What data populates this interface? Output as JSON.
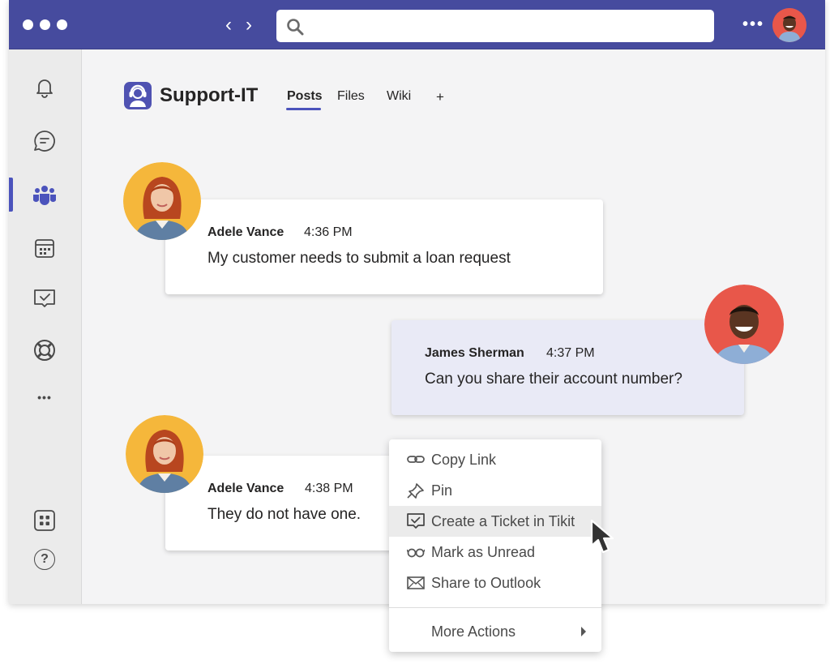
{
  "titlebar": {
    "nav_back": "‹",
    "nav_forward": "›",
    "more": "•••",
    "search": {
      "placeholder": ""
    }
  },
  "rail": {
    "items": [
      {
        "name": "activity",
        "icon": "bell-icon"
      },
      {
        "name": "chat",
        "icon": "chat-icon"
      },
      {
        "name": "teams",
        "icon": "teams-icon",
        "active": true
      },
      {
        "name": "calendar",
        "icon": "calendar-icon"
      },
      {
        "name": "tasks",
        "icon": "task-check-icon"
      },
      {
        "name": "help-desk",
        "icon": "lifebuoy-icon"
      },
      {
        "name": "more",
        "icon": "ellipsis-icon",
        "label": "•••"
      },
      {
        "name": "apps",
        "icon": "apps-icon"
      },
      {
        "name": "help",
        "icon": "help-icon",
        "label": "?"
      }
    ]
  },
  "channel": {
    "title": "Support-IT",
    "tabs": [
      {
        "label": "Posts",
        "active": true
      },
      {
        "label": "Files"
      },
      {
        "label": "Wiki"
      },
      {
        "label": "+"
      }
    ]
  },
  "messages": [
    {
      "author": "Adele Vance",
      "time": "4:36 PM",
      "text": "My customer needs to submit a loan request"
    },
    {
      "author": "James Sherman",
      "time": "4:37 PM",
      "text": "Can you share their account number?"
    },
    {
      "author": "Adele Vance",
      "time": "4:38 PM",
      "text": "They do not have one."
    }
  ],
  "context_menu": {
    "items": [
      {
        "label": "Copy Link",
        "icon": "link-icon"
      },
      {
        "label": "Pin",
        "icon": "pin-icon"
      },
      {
        "label": "Create a Ticket in Tikit",
        "icon": "ticket-check-icon",
        "highlighted": true
      },
      {
        "label": "Mark as Unread",
        "icon": "glasses-icon"
      },
      {
        "label": "Share to Outlook",
        "icon": "mail-icon"
      }
    ],
    "more_actions": "More Actions"
  },
  "colors": {
    "accent": "#4b53bc",
    "titlebar": "#464b9e",
    "own_message": "#e9eaf6"
  }
}
